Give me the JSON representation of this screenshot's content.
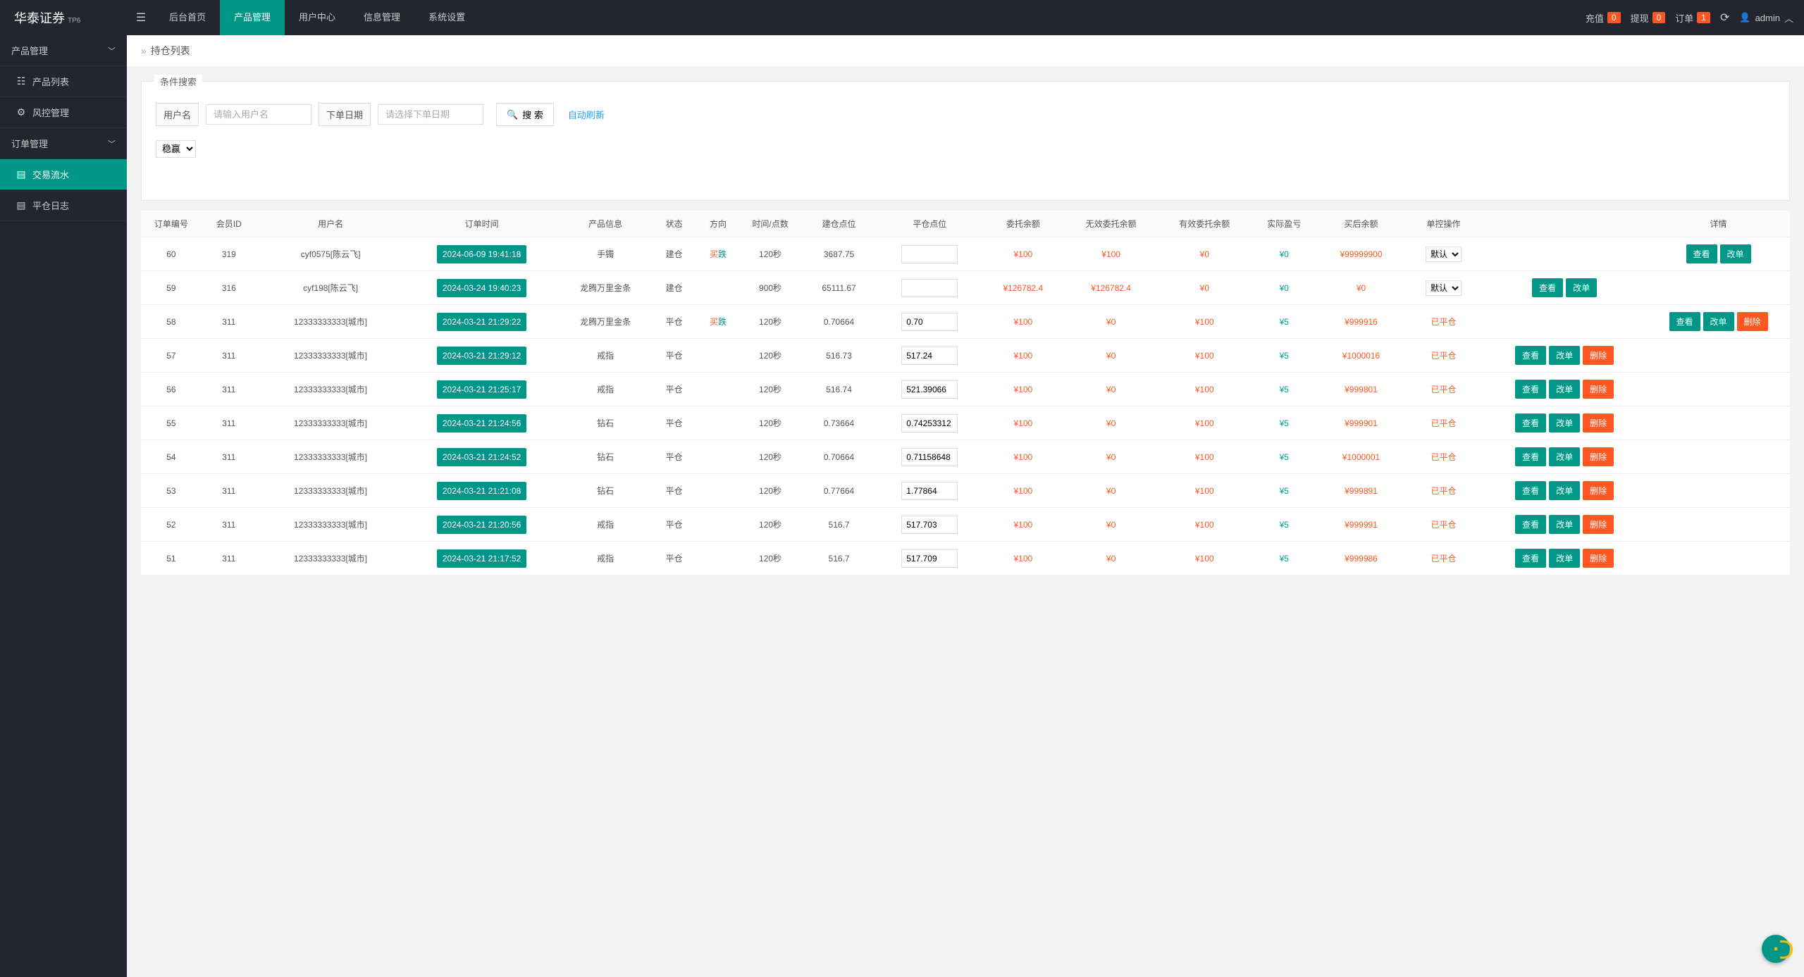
{
  "brand": {
    "name": "华泰证券",
    "sup": "TP6"
  },
  "topnav": {
    "items": [
      "后台首页",
      "产品管理",
      "用户中心",
      "信息管理",
      "系统设置"
    ],
    "active": 1
  },
  "topright": {
    "recharge": {
      "label": "充值",
      "count": "0"
    },
    "withdraw": {
      "label": "提现",
      "count": "0"
    },
    "order": {
      "label": "订单",
      "count": "1"
    },
    "user": "admin"
  },
  "sidebar": {
    "group1": {
      "title": "产品管理",
      "items": [
        "产品列表",
        "风控管理"
      ]
    },
    "group2": {
      "title": "订单管理",
      "items": [
        "交易流水",
        "平仓日志"
      ],
      "active": 0
    }
  },
  "breadcrumb": {
    "label": "持仓列表"
  },
  "search": {
    "legend": "条件搜索",
    "user_label": "用户名",
    "user_placeholder": "请输入用户名",
    "date_label": "下单日期",
    "date_placeholder": "请选择下单日期",
    "btn": "搜 索",
    "auto": "自动刷新",
    "sel": "稳赢"
  },
  "table": {
    "headers": [
      "订单编号",
      "会员ID",
      "用户名",
      "订单时间",
      "产品信息",
      "状态",
      "方向",
      "时间/点数",
      "建仓点位",
      "平仓点位",
      "委托余额",
      "无效委托余额",
      "有效委托余额",
      "实际盈亏",
      "买后余额",
      "单控操作",
      "",
      "详情"
    ],
    "ctl_default": "默认",
    "btn_view": "查看",
    "btn_edit": "改单",
    "btn_del": "删除",
    "rows": [
      {
        "id": "60",
        "mid": "319",
        "uname": "cyf0575[陈云飞]",
        "time": "2024-06-09 19:41:18",
        "prod": "手镯",
        "status": "建仓",
        "dir": "买跌",
        "dir_mixed": true,
        "tp": "120秒",
        "open": "3687.75",
        "close": "",
        "c1": "¥100",
        "c2": "¥100",
        "c3": "¥0",
        "c4": "¥0",
        "c5": "¥99999900",
        "ctl": "select",
        "closed": false,
        "ops": [
          "view",
          "edit"
        ],
        "ops_right": true
      },
      {
        "id": "59",
        "mid": "316",
        "uname": "cyf198[陈云飞]",
        "time": "2024-03-24 19:40:23",
        "prod": "龙腾万里金条",
        "status": "建仓",
        "dir": "",
        "tp": "900秒",
        "open": "65111.67",
        "close": "",
        "c1": "¥126782.4",
        "c2": "¥126782.4",
        "c3": "¥0",
        "c4": "¥0",
        "c5": "¥0",
        "ctl": "select",
        "closed": false,
        "ops": [
          "view",
          "edit"
        ],
        "ops_right": false
      },
      {
        "id": "58",
        "mid": "311",
        "uname": "12333333333[城市]",
        "time": "2024-03-21 21:29:22",
        "prod": "龙腾万里金条",
        "status": "平仓",
        "dir": "买跌",
        "dir_mixed": true,
        "tp": "120秒",
        "open": "0.70664",
        "close": "0.70",
        "c1": "¥100",
        "c2": "¥0",
        "c3": "¥100",
        "c4": "¥5",
        "c5": "¥999916",
        "ctl": "text",
        "closed": true,
        "ops": [
          "view",
          "edit",
          "del"
        ],
        "ops_right": true
      },
      {
        "id": "57",
        "mid": "311",
        "uname": "12333333333[城市]",
        "time": "2024-03-21 21:29:12",
        "prod": "戒指",
        "status": "平仓",
        "dir": "",
        "tp": "120秒",
        "open": "516.73",
        "close": "517.24",
        "c1": "¥100",
        "c2": "¥0",
        "c3": "¥100",
        "c4": "¥5",
        "c5": "¥1000016",
        "ctl": "text",
        "closed": true,
        "ops": [
          "view",
          "edit",
          "del"
        ],
        "ops_right": false
      },
      {
        "id": "56",
        "mid": "311",
        "uname": "12333333333[城市]",
        "time": "2024-03-21 21:25:17",
        "prod": "戒指",
        "status": "平仓",
        "dir": "",
        "tp": "120秒",
        "open": "516.74",
        "close": "521.39066",
        "c1": "¥100",
        "c2": "¥0",
        "c3": "¥100",
        "c4": "¥5",
        "c5": "¥999801",
        "ctl": "text",
        "closed": true,
        "ops": [
          "view",
          "edit",
          "del"
        ],
        "ops_right": false
      },
      {
        "id": "55",
        "mid": "311",
        "uname": "12333333333[城市]",
        "time": "2024-03-21 21:24:56",
        "prod": "钻石",
        "status": "平仓",
        "dir": "",
        "tp": "120秒",
        "open": "0.73664",
        "close": "0.74253312",
        "c1": "¥100",
        "c2": "¥0",
        "c3": "¥100",
        "c4": "¥5",
        "c5": "¥999901",
        "ctl": "text",
        "closed": true,
        "ops": [
          "view",
          "edit",
          "del"
        ],
        "ops_right": false
      },
      {
        "id": "54",
        "mid": "311",
        "uname": "12333333333[城市]",
        "time": "2024-03-21 21:24:52",
        "prod": "钻石",
        "status": "平仓",
        "dir": "",
        "tp": "120秒",
        "open": "0.70664",
        "close": "0.71158648",
        "c1": "¥100",
        "c2": "¥0",
        "c3": "¥100",
        "c4": "¥5",
        "c5": "¥1000001",
        "ctl": "text",
        "closed": true,
        "ops": [
          "view",
          "edit",
          "del"
        ],
        "ops_right": false
      },
      {
        "id": "53",
        "mid": "311",
        "uname": "12333333333[城市]",
        "time": "2024-03-21 21:21:08",
        "prod": "钻石",
        "status": "平仓",
        "dir": "",
        "tp": "120秒",
        "open": "0.77664",
        "close": "1.77864",
        "c1": "¥100",
        "c2": "¥0",
        "c3": "¥100",
        "c4": "¥5",
        "c5": "¥999891",
        "ctl": "text",
        "closed": true,
        "ops": [
          "view",
          "edit",
          "del"
        ],
        "ops_right": false
      },
      {
        "id": "52",
        "mid": "311",
        "uname": "12333333333[城市]",
        "time": "2024-03-21 21:20:56",
        "prod": "戒指",
        "status": "平仓",
        "dir": "",
        "tp": "120秒",
        "open": "516.7",
        "close": "517.703",
        "c1": "¥100",
        "c2": "¥0",
        "c3": "¥100",
        "c4": "¥5",
        "c5": "¥999991",
        "ctl": "text",
        "closed": true,
        "ops": [
          "view",
          "edit",
          "del"
        ],
        "ops_right": false
      },
      {
        "id": "51",
        "mid": "311",
        "uname": "12333333333[城市]",
        "time": "2024-03-21 21:17:52",
        "prod": "戒指",
        "status": "平仓",
        "dir": "",
        "tp": "120秒",
        "open": "516.7",
        "close": "517.709",
        "c1": "¥100",
        "c2": "¥0",
        "c3": "¥100",
        "c4": "¥5",
        "c5": "¥999986",
        "ctl": "text",
        "closed": true,
        "ops": [
          "view",
          "edit",
          "del"
        ],
        "ops_right": false
      }
    ]
  }
}
